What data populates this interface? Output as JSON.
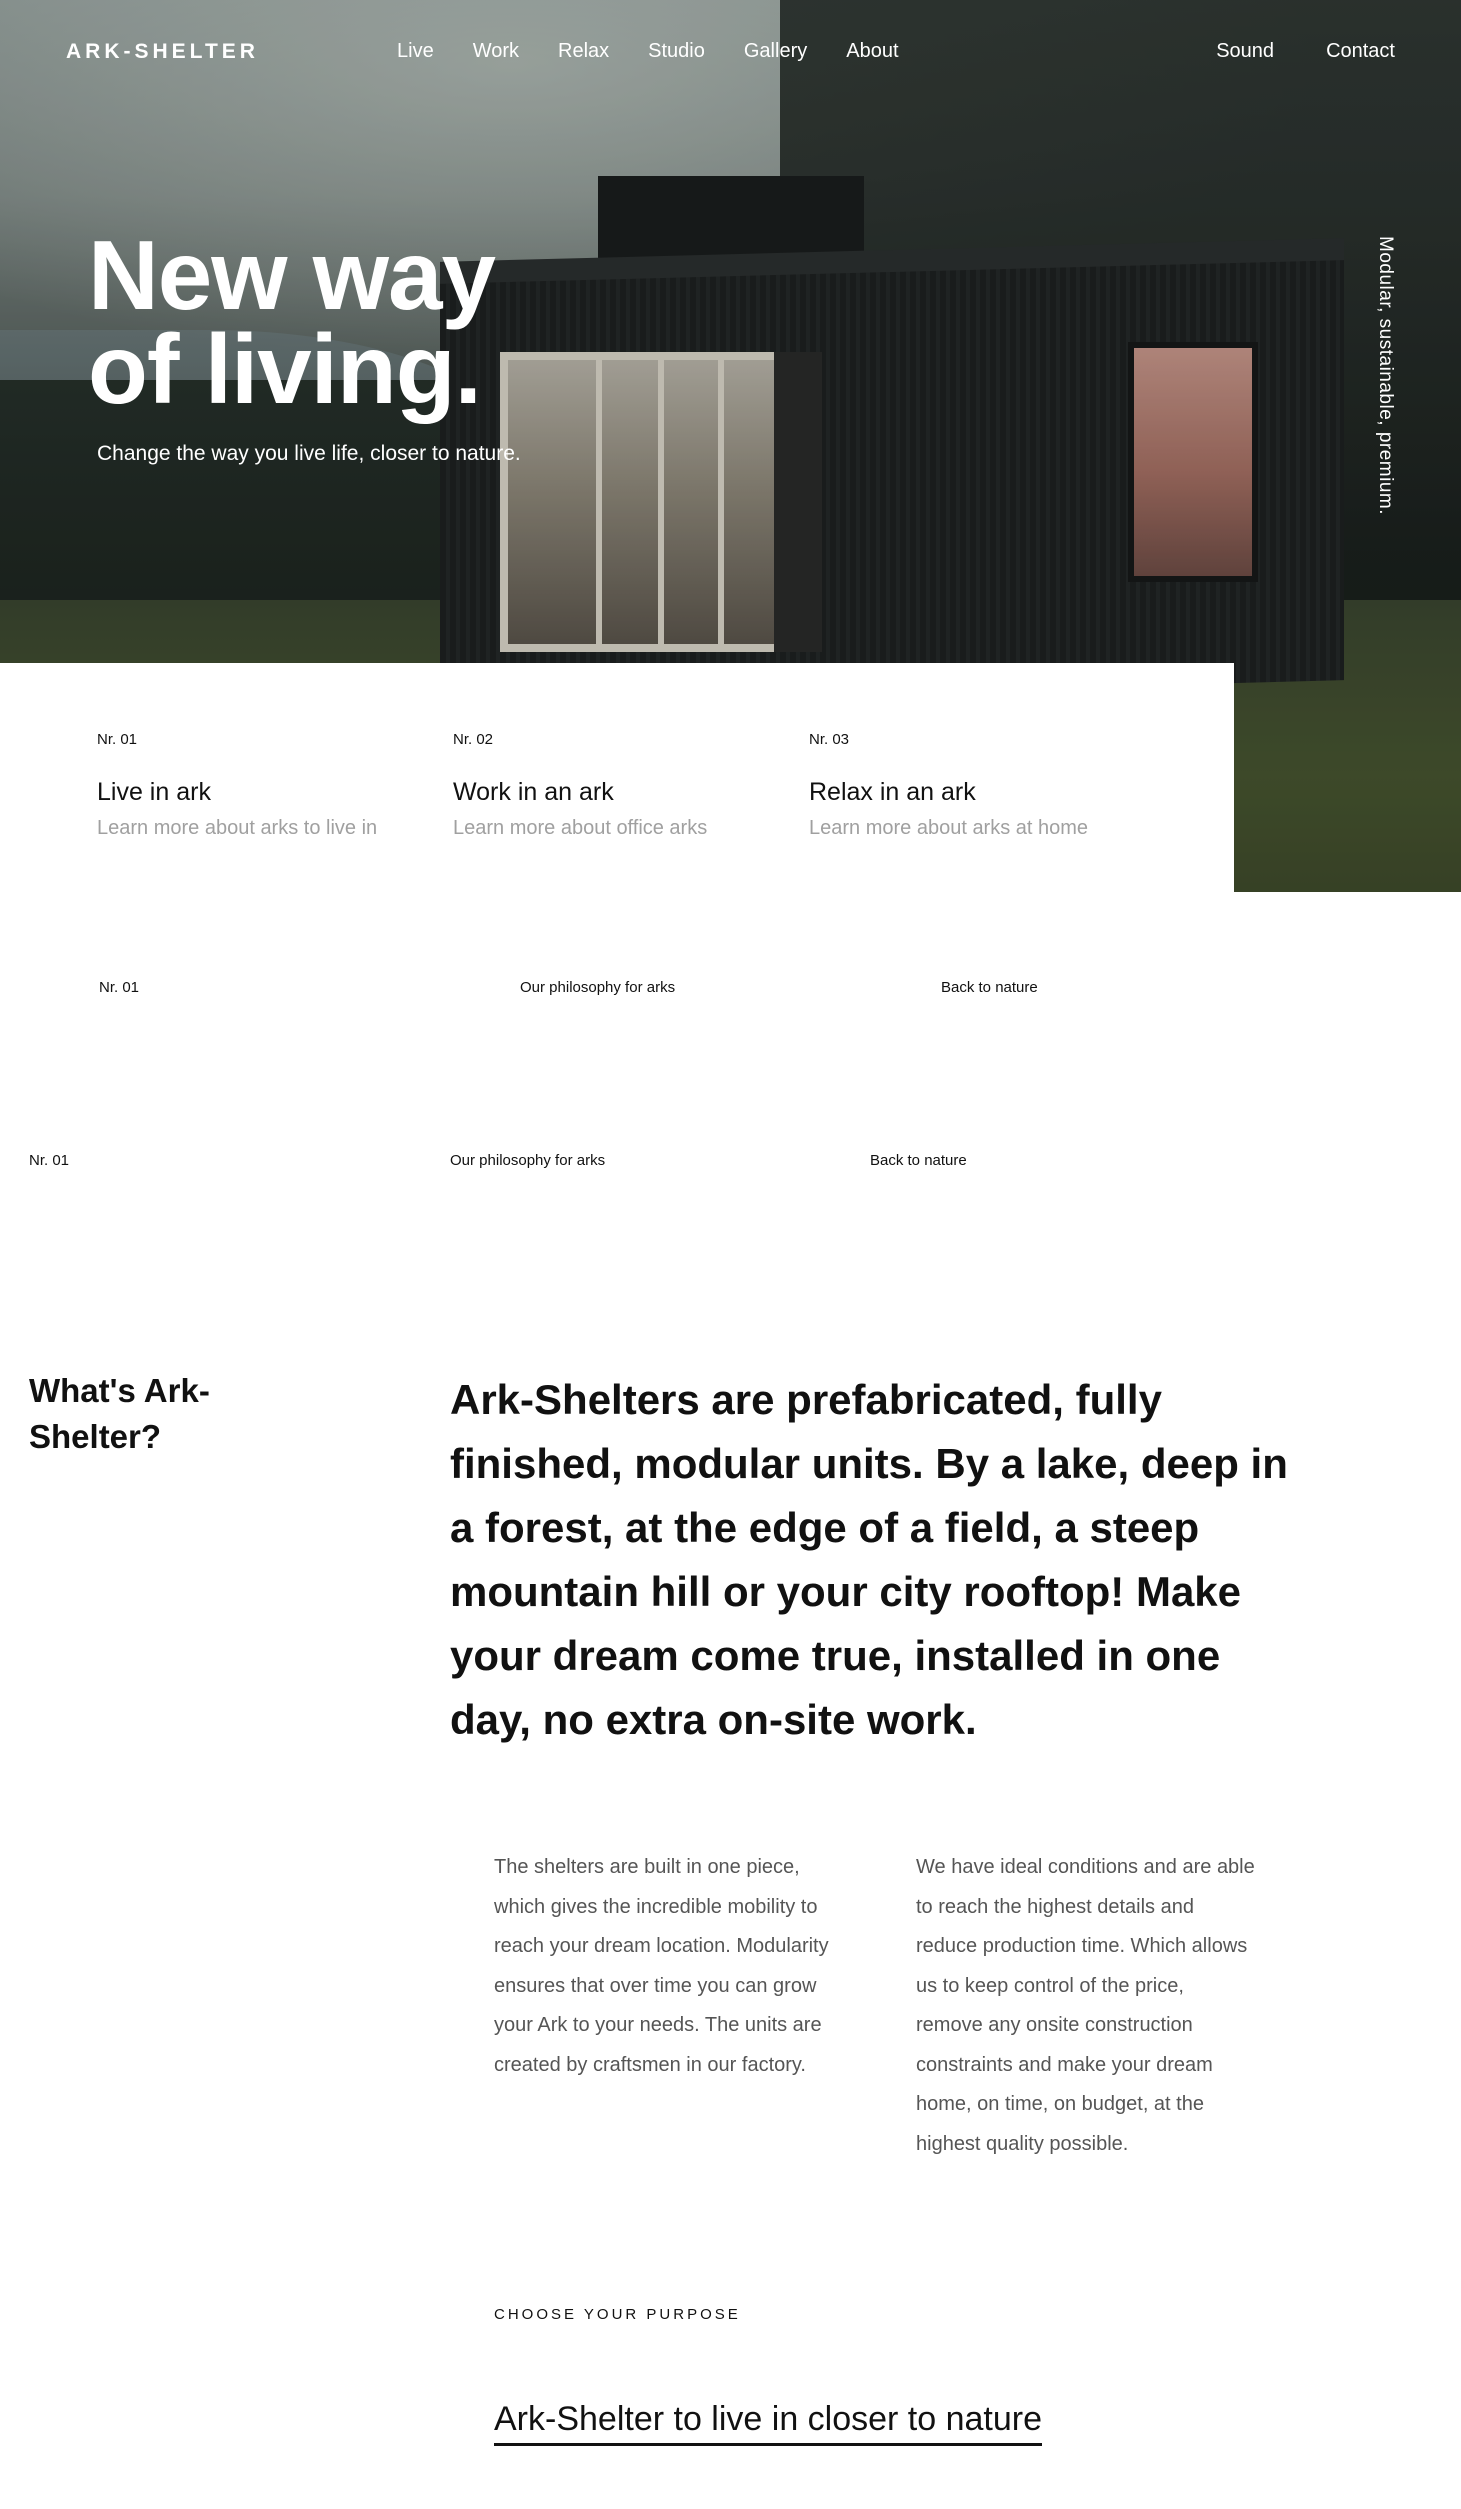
{
  "nav": {
    "logo": "ARK-SHELTER",
    "links": [
      "Live",
      "Work",
      "Relax",
      "Studio",
      "Gallery",
      "About"
    ],
    "right_links": [
      "Sound",
      "Contact"
    ]
  },
  "hero": {
    "title_line1": "New way",
    "title_line2": "of living.",
    "subtitle": "Change the way you live life, closer to nature.",
    "vertical_tag": "Modular, sustainable, premium."
  },
  "cards": [
    {
      "num": "Nr. 01",
      "title": "Live in ark",
      "desc": "Learn more about arks to live in"
    },
    {
      "num": "Nr. 02",
      "title": "Work in an ark",
      "desc": "Learn more about office arks"
    },
    {
      "num": "Nr. 03",
      "title": "Relax in an ark",
      "desc": "Learn more about arks at home"
    }
  ],
  "labels_row1": [
    "Nr. 01",
    "Our philosophy for arks",
    "Back to nature"
  ],
  "labels_row2": [
    "Nr. 01",
    "Our philosophy for arks",
    "Back to nature"
  ],
  "about": {
    "heading": "What's Ark-Shelter?",
    "lead": "Ark-Shelters are prefabricated, fully finished, modular units. By a lake, deep in a forest, at the edge of a field, a steep mountain hill or your city rooftop! Make your dream come true, installed in one day, no extra on-site work.",
    "col1": "The shelters are built in one piece, which gives the incredible mobility to reach your dream location. Modularity ensures that over time you can grow your Ark to your needs. The units are created by craftsmen in our factory.",
    "col2": "We have ideal conditions and are able to reach the highest details and reduce production time. Which allows us to keep control of the price, remove any onsite construction constraints and make your dream home, on time, on budget, at the highest quality possible."
  },
  "purpose": {
    "label": "CHOOSE YOUR PURPOSE",
    "link": "Ark-Shelter to live in closer to nature"
  }
}
